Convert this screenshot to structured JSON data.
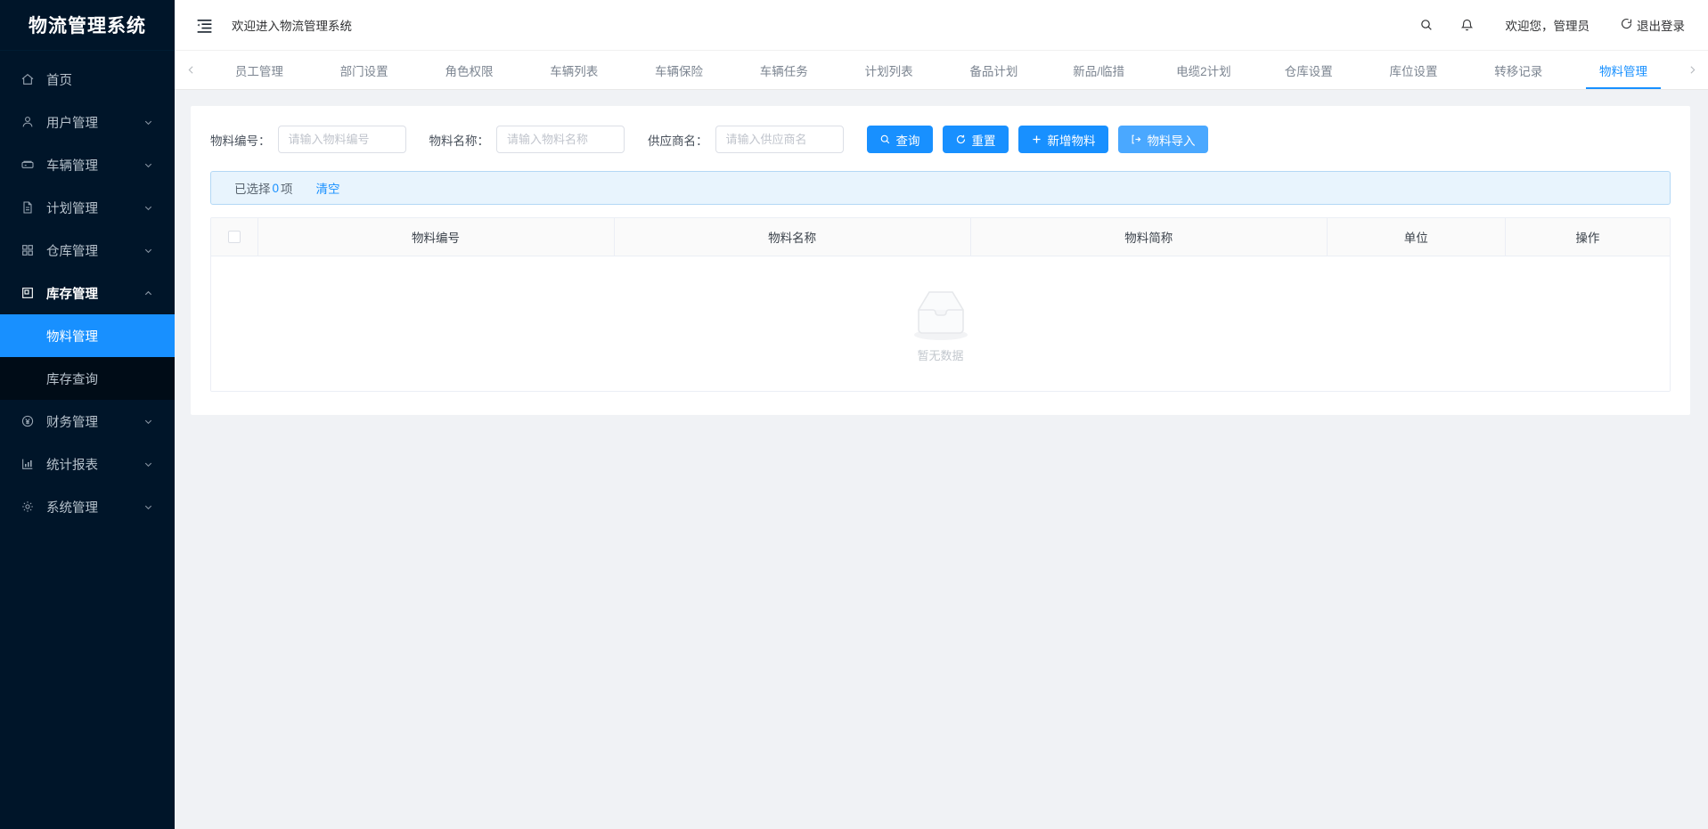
{
  "sidebar": {
    "logo": "物流管理系统",
    "items": [
      {
        "label": "首页",
        "icon": "home-icon",
        "arrow": false
      },
      {
        "label": "用户管理",
        "icon": "user-icon",
        "arrow": true
      },
      {
        "label": "车辆管理",
        "icon": "car-icon",
        "arrow": true
      },
      {
        "label": "计划管理",
        "icon": "document-icon",
        "arrow": true
      },
      {
        "label": "仓库管理",
        "icon": "grid-icon",
        "arrow": true
      },
      {
        "label": "库存管理",
        "icon": "box-icon",
        "arrow": true,
        "expanded": true
      },
      {
        "label": "财务管理",
        "icon": "money-circle-icon",
        "arrow": true
      },
      {
        "label": "统计报表",
        "icon": "bar-chart-icon",
        "arrow": true
      },
      {
        "label": "系统管理",
        "icon": "gear-icon",
        "arrow": true
      }
    ],
    "submenu": [
      {
        "label": "物料管理",
        "active": true
      },
      {
        "label": "库存查询",
        "active": false
      }
    ]
  },
  "header": {
    "fold_icon": "menu-fold-icon",
    "welcome": "欢迎进入物流管理系统",
    "search_icon": "search-icon",
    "bell_icon": "bell-icon",
    "user_greeting": "欢迎您，管理员",
    "logout_label": "退出登录",
    "logout_icon": "logout-icon"
  },
  "tabs": {
    "prev_icon": "chevron-left-icon",
    "next_icon": "chevron-right-icon",
    "items": [
      {
        "label": "员工管理",
        "active": false
      },
      {
        "label": "部门设置",
        "active": false
      },
      {
        "label": "角色权限",
        "active": false
      },
      {
        "label": "车辆列表",
        "active": false
      },
      {
        "label": "车辆保险",
        "active": false
      },
      {
        "label": "车辆任务",
        "active": false
      },
      {
        "label": "计划列表",
        "active": false
      },
      {
        "label": "备品计划",
        "active": false
      },
      {
        "label": "新品/临措",
        "active": false
      },
      {
        "label": "电缆2计划",
        "active": false
      },
      {
        "label": "仓库设置",
        "active": false
      },
      {
        "label": "库位设置",
        "active": false
      },
      {
        "label": "转移记录",
        "active": false
      },
      {
        "label": "物料管理",
        "active": true
      }
    ]
  },
  "search_form": {
    "fields": [
      {
        "label": "物料编号：",
        "placeholder": "请输入物料编号",
        "value": ""
      },
      {
        "label": "物料名称：",
        "placeholder": "请输入物料名称",
        "value": ""
      },
      {
        "label": "供应商名：",
        "placeholder": "请输入供应商名",
        "value": ""
      }
    ],
    "buttons": [
      {
        "label": "查询",
        "icon": "search-icon",
        "style": "primary"
      },
      {
        "label": "重置",
        "icon": "refresh-icon",
        "style": "primary"
      },
      {
        "label": "新增物料",
        "icon": "plus-icon",
        "style": "primary"
      },
      {
        "label": "物料导入",
        "icon": "import-icon",
        "style": "light"
      }
    ]
  },
  "selection_bar": {
    "prefix": "已选择",
    "count": "0",
    "suffix": "项",
    "clear_label": "清空"
  },
  "table": {
    "columns": [
      "物料编号",
      "物料名称",
      "物料简称",
      "单位",
      "操作"
    ],
    "rows": [],
    "empty_text": "暂无数据",
    "empty_icon": "empty-box-icon"
  },
  "colors": {
    "accent": "#1890ff",
    "sidebar_bg": "#001529",
    "submenu_bg": "#000c17",
    "page_bg": "#f0f2f5",
    "selbar_bg": "#e8f4fd",
    "selbar_border": "#b3d8f5"
  }
}
